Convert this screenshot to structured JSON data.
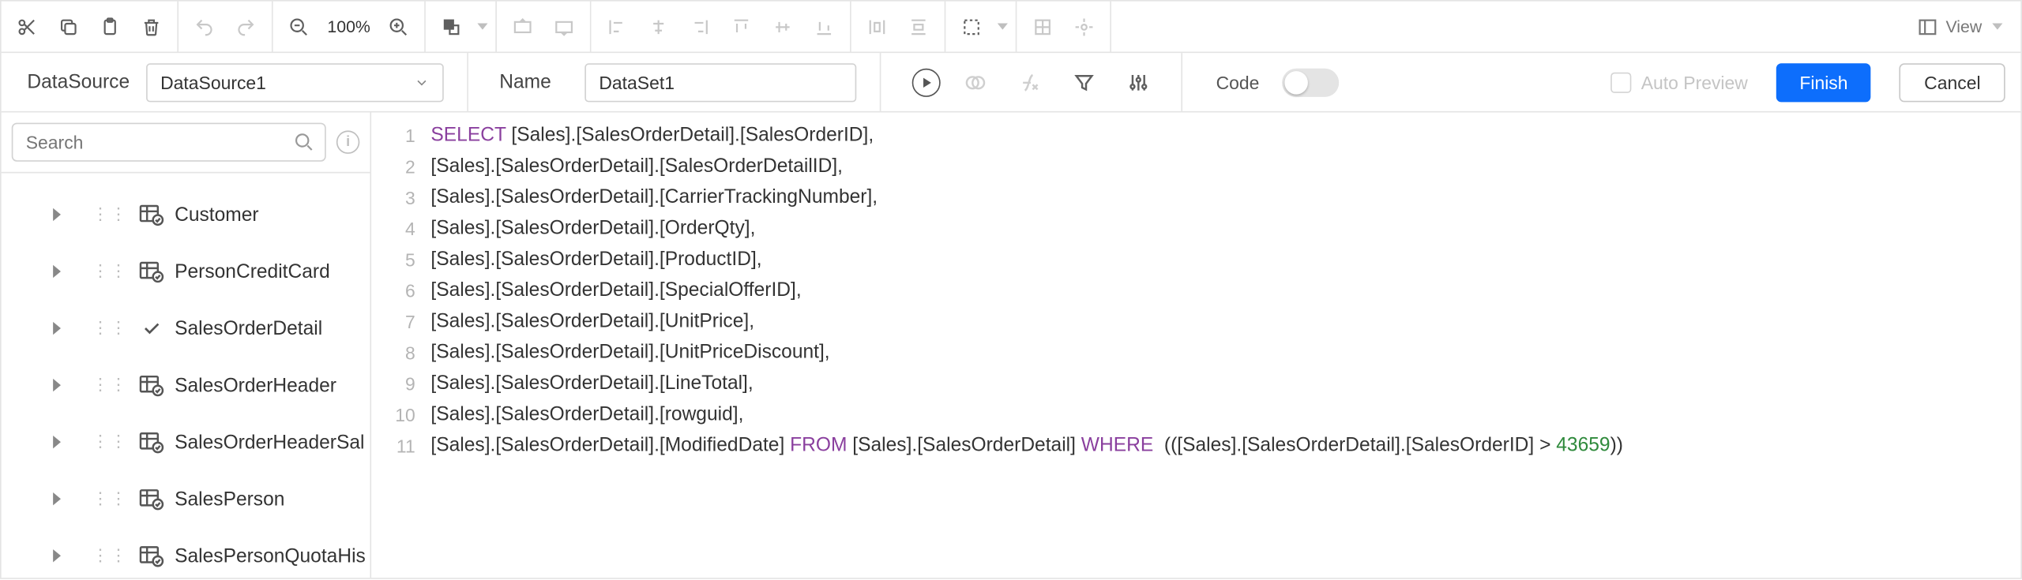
{
  "toolbar": {
    "zoom": "100%",
    "view_label": "View"
  },
  "config": {
    "datasource_label": "DataSource",
    "datasource_value": "DataSource1",
    "name_label": "Name",
    "name_value": "DataSet1",
    "code_label": "Code",
    "auto_preview_label": "Auto Preview",
    "finish_label": "Finish",
    "cancel_label": "Cancel"
  },
  "sidebar": {
    "search_placeholder": "Search",
    "items": [
      {
        "label": "Customer",
        "selected": false
      },
      {
        "label": "PersonCreditCard",
        "selected": false
      },
      {
        "label": "SalesOrderDetail",
        "selected": true
      },
      {
        "label": "SalesOrderHeader",
        "selected": false
      },
      {
        "label": "SalesOrderHeaderSal",
        "selected": false
      },
      {
        "label": "SalesPerson",
        "selected": false
      },
      {
        "label": "SalesPersonQuotaHis",
        "selected": false
      }
    ]
  },
  "sql": {
    "lines": [
      [
        {
          "t": "SELECT",
          "c": "kw"
        },
        {
          "t": " [Sales].[SalesOrderDetail].[SalesOrderID],"
        }
      ],
      [
        {
          "t": "[Sales].[SalesOrderDetail].[SalesOrderDetailID],"
        }
      ],
      [
        {
          "t": "[Sales].[SalesOrderDetail].[CarrierTrackingNumber],"
        }
      ],
      [
        {
          "t": "[Sales].[SalesOrderDetail].[OrderQty],"
        }
      ],
      [
        {
          "t": "[Sales].[SalesOrderDetail].[ProductID],"
        }
      ],
      [
        {
          "t": "[Sales].[SalesOrderDetail].[SpecialOfferID],"
        }
      ],
      [
        {
          "t": "[Sales].[SalesOrderDetail].[UnitPrice],"
        }
      ],
      [
        {
          "t": "[Sales].[SalesOrderDetail].[UnitPriceDiscount],"
        }
      ],
      [
        {
          "t": "[Sales].[SalesOrderDetail].[LineTotal],"
        }
      ],
      [
        {
          "t": "[Sales].[SalesOrderDetail].[rowguid],"
        }
      ],
      [
        {
          "t": "[Sales].[SalesOrderDetail].[ModifiedDate] "
        },
        {
          "t": "FROM",
          "c": "kw"
        },
        {
          "t": " [Sales].[SalesOrderDetail] "
        },
        {
          "t": "WHERE",
          "c": "kw"
        },
        {
          "t": "  (([Sales].[SalesOrderDetail].[SalesOrderID] > "
        },
        {
          "t": "43659",
          "c": "num"
        },
        {
          "t": "))"
        }
      ]
    ]
  }
}
